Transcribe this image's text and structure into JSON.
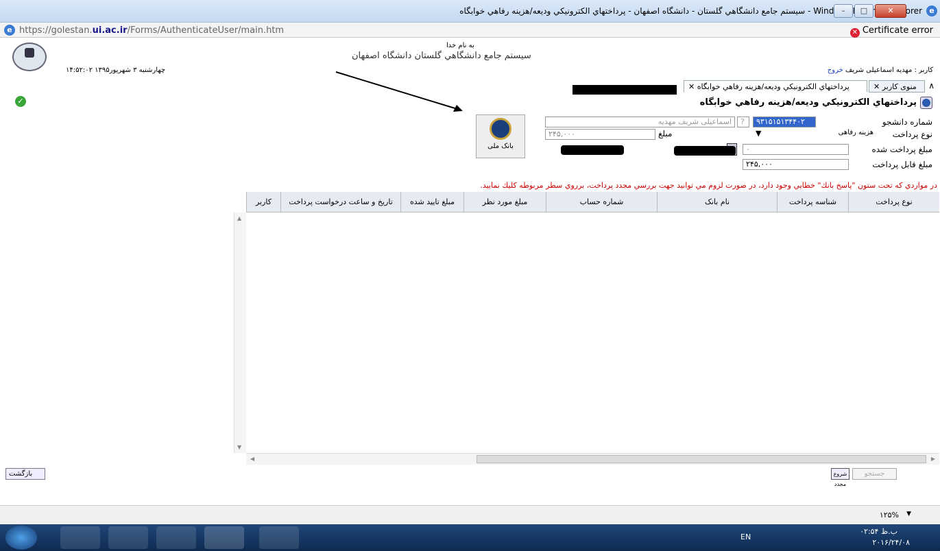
{
  "window": {
    "title": "سيستم جامع دانشگاهي گلستان - دانشگاه اصفهان - پرداختهاي الکترونيکي وديعه/هزينه رفاهي خوابگاه - Windows Internet Explorer"
  },
  "address": {
    "url_prefix": "https://golestan.",
    "url_host": "ui.ac.ir",
    "url_path": "/Forms/AuthenticateUser/main.htm",
    "cert": "Certificate error"
  },
  "header": {
    "bismillah": "به نام خدا",
    "system_name": "سيستم جامع دانشگاهي گلستان    دانشگاه اصفهان",
    "datetime": "۱۴:۵۲:۰۲  چهارشنبه ۳ شهریور۱۳۹۵",
    "user_label": "کاربر : مهدیه اسماعیلی شریف",
    "logout": "خروج"
  },
  "tabs": [
    {
      "label": "منوی کاربر"
    },
    {
      "label": "پرداختهاي الكترونيكي وديعه/هزينه رفاهي خوابگاه"
    }
  ],
  "form": {
    "page_title": "پرداختهاي الكترونيكي وديعه/هزينه رفاهي خوابگاه",
    "student_no_label": "شماره دانشجو",
    "student_no_value": "۹۳۱۵۱۵۱۳۴۴۰۲",
    "student_name_value": "اسماعیلی شریف مهدیه",
    "pay_type_label": "نوع پرداخت",
    "pay_type_value": "هزینه رفاهی",
    "amount_label": "مبلغ",
    "amount_value": "۲۴۵,۰۰۰",
    "paid_label": "مبلغ پرداخت شده",
    "paid_value": "۰",
    "payable_label": "مبلغ قابل پرداخت",
    "payable_value": "۲۴۵,۰۰۰",
    "bank_name": "بانک ملی",
    "notice": "در مواردي كه تحت ستون \"پاسخ بانك\" خطايي وجود دارد، در صورت لزوم مي توانيد جهت بررسي مجدد پرداخت، برروي سطر مربوطه كليك نماييد."
  },
  "table": {
    "columns": [
      "نوع پرداخت",
      "شناسه پرداخت",
      "نام بانک",
      "شماره حساب",
      "مبلغ مورد نظر",
      "مبلغ تایید شده",
      "تاریخ و ساعت درخواست پرداخت",
      "کاربر"
    ]
  },
  "footer": {
    "back_button": "بازگشت",
    "search_button": "جستجو",
    "refresh_button": "شروع مجدد"
  },
  "statusbar": {
    "zoom": "۱۲۵%"
  },
  "taskbar": {
    "lang": "EN",
    "time": "۰۲:۵۴ ب.ظ",
    "date": "۲۰۱۶/۲۴/۰۸"
  },
  "colors": {
    "accent_blue": "#1a3fbf",
    "notice_red": "#d00000",
    "taskbar": "#1f4778"
  }
}
